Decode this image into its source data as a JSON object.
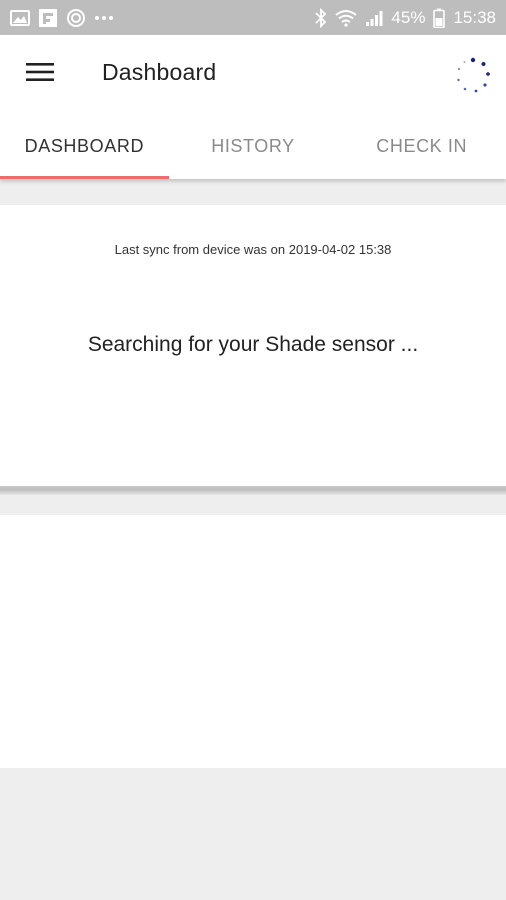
{
  "status_bar": {
    "battery": "45%",
    "time": "15:38",
    "icons": [
      "gallery-icon",
      "flipboard-icon",
      "sync-icon",
      "more-dots-icon",
      "bluetooth-icon",
      "wifi-icon",
      "signal-icon",
      "battery-icon"
    ]
  },
  "app_bar": {
    "title": "Dashboard",
    "menu_icon": "hamburger-menu-icon",
    "loading_icon": "loading-spinner-icon"
  },
  "tabs": [
    {
      "label": "DASHBOARD",
      "active": true
    },
    {
      "label": "HISTORY",
      "active": false
    },
    {
      "label": "CHECK IN",
      "active": false
    }
  ],
  "card": {
    "sync_text": "Last sync from device was on 2019-04-02 15:38",
    "search_text": "Searching for your Shade sensor ..."
  },
  "colors": {
    "accent": "#ef6c6c",
    "spinner": "#1a237e",
    "status_bar": "#bdbdbd"
  }
}
